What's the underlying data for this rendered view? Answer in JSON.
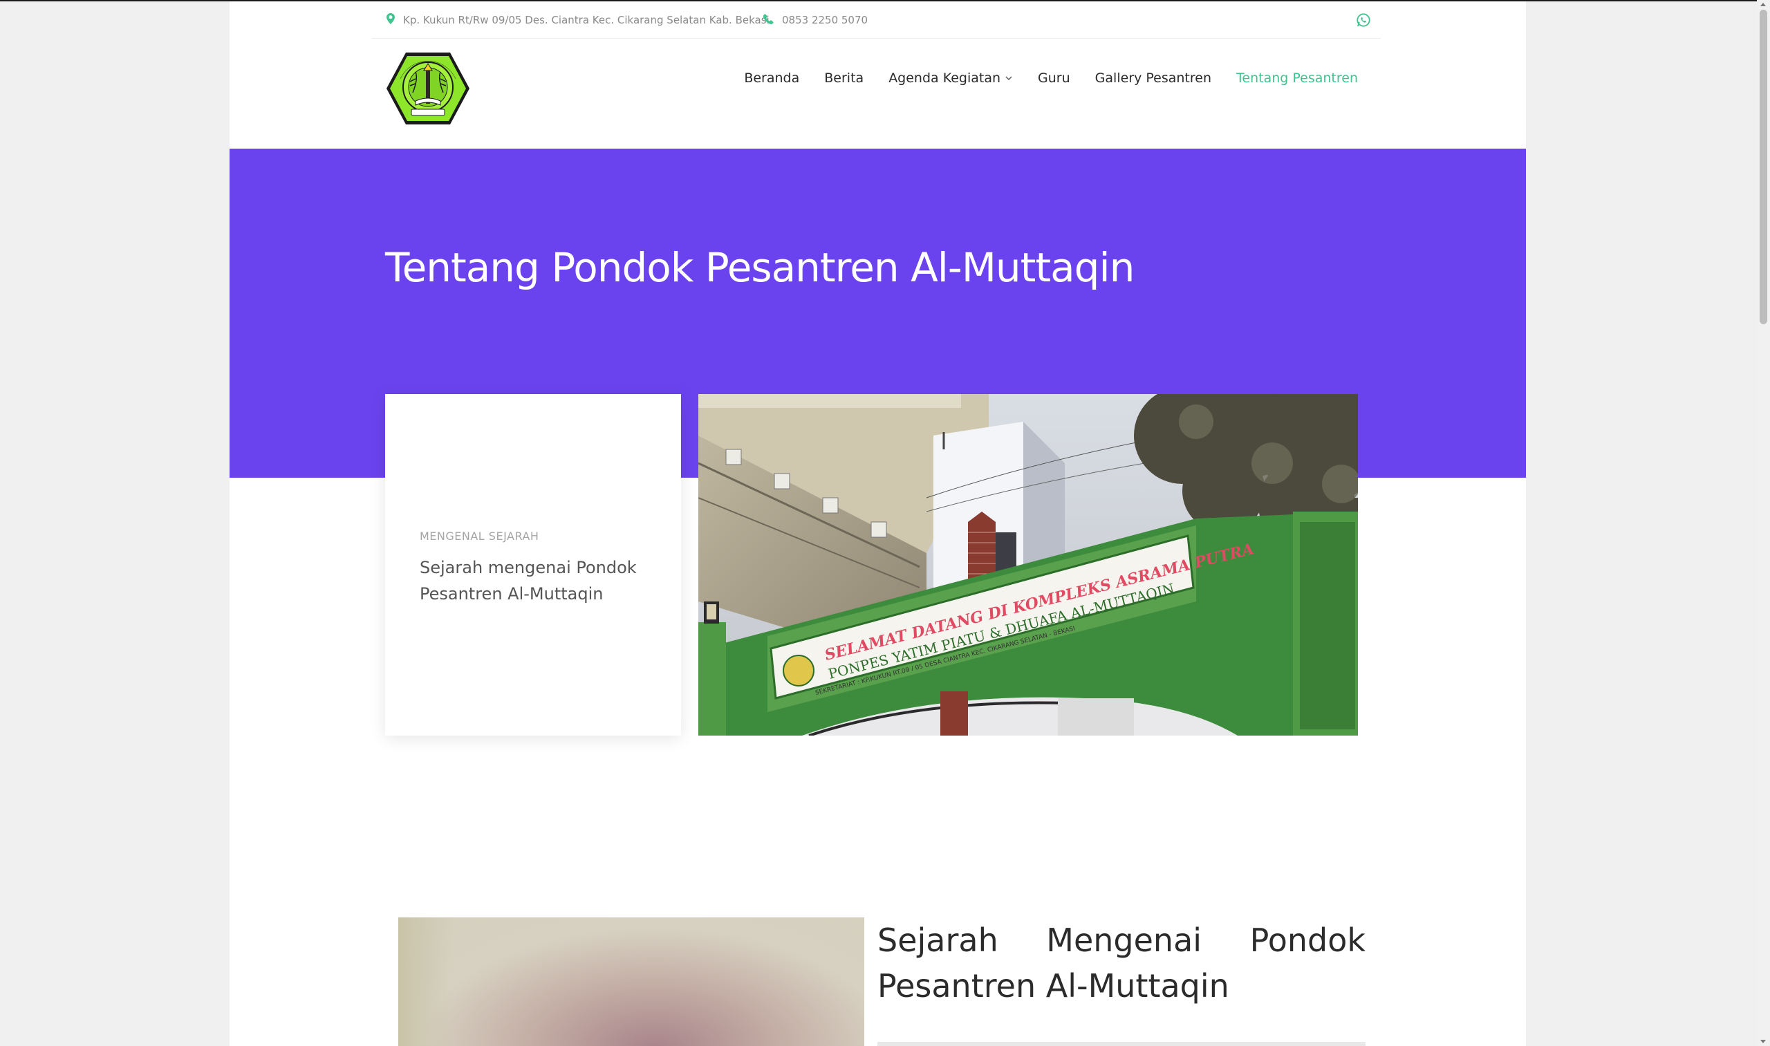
{
  "topbar": {
    "address": "Kp. Kukun Rt/Rw 09/05 Des. Ciantra Kec. Cikarang Selatan Kab. Bekasi",
    "phone": "0853 2250 5070",
    "address_icon": "map-pin-icon",
    "phone_icon": "phone-icon",
    "social_icon": "whatsapp-icon"
  },
  "logo": {
    "top_text": "PONPES YATIM PIATU & DHUAFA",
    "bottom_text": "AL-MUTTAQIN"
  },
  "nav": {
    "items": [
      {
        "label": "Beranda"
      },
      {
        "label": "Berita"
      },
      {
        "label": "Agenda Kegiatan"
      },
      {
        "label": "Guru"
      },
      {
        "label": "Gallery Pesantren"
      },
      {
        "label": "Tentang Pesantren"
      }
    ],
    "active": "Tentang Pesantren"
  },
  "hero": {
    "title": "Tentang Pondok Pesantren Al-Muttaqin"
  },
  "card": {
    "kicker": "MENGENAL SEJARAH",
    "description": "Sejarah mengenai Pondok Pesantren Al-Muttaqin"
  },
  "photo": {
    "sign_line1": "SELAMAT DATANG DI KOMPLEKS ASRAMA PUTRA",
    "sign_line2": "PONPES YATIM PIATU & DHUAFA AL-MUTTAQIN",
    "sign_line3": "SEKRETARIAT : KP.KUKUN RT.09 / 05 DESA CIANTRA KEC. CIKARANG SELATAN - BEKASI"
  },
  "section": {
    "title": "Sejarah Mengenai Pondok Pesantren Al-Muttaqin"
  },
  "colors": {
    "accent": "#3fc48f",
    "hero_bg": "#6b43ee",
    "text": "#2b2b2b"
  }
}
